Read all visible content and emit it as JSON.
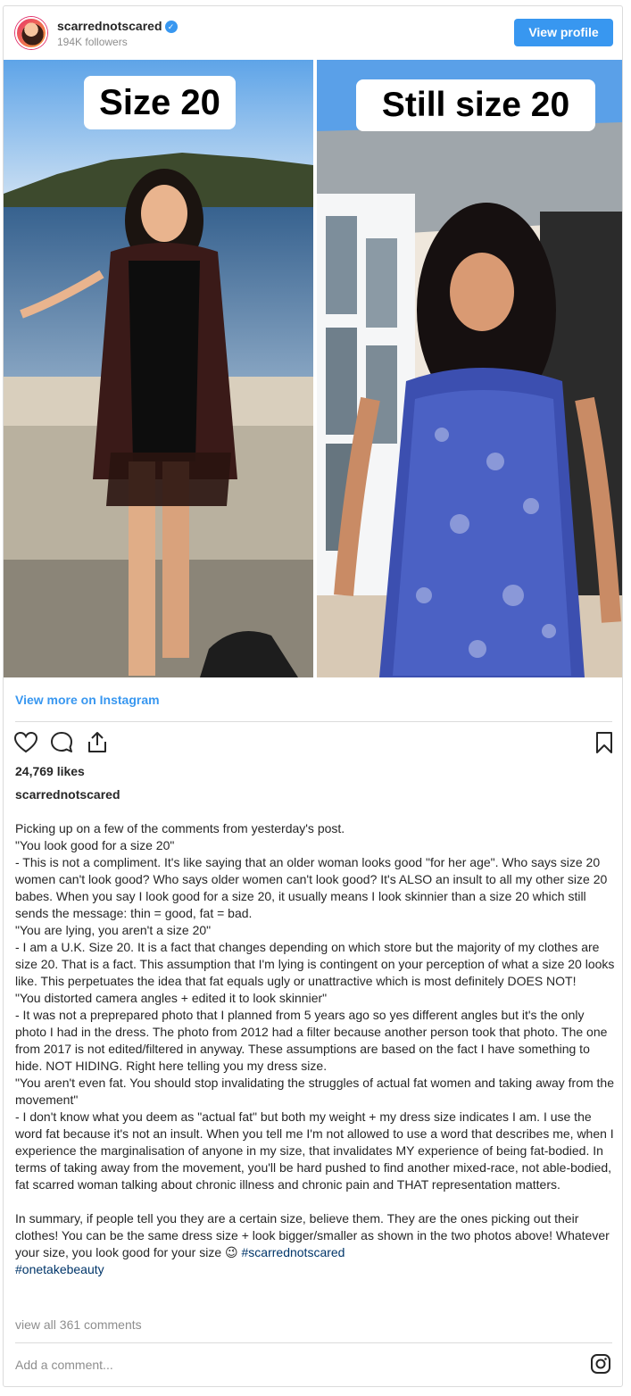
{
  "header": {
    "username": "scarrednotscared",
    "followers": "194K followers",
    "view_profile": "View profile"
  },
  "photos": {
    "left_label": "Size 20",
    "right_label": "Still size 20"
  },
  "view_more": "View more on Instagram",
  "likes": "24,769 likes",
  "owner": "scarrednotscared",
  "caption": {
    "body": "Picking up on a few of the comments from yesterday's post.\n\"You look good for a size 20\"\n- This is not a compliment. It's like saying that an older woman looks good \"for her age\". Who says size 20 women can't look good? Who says older women can't look good? It's ALSO an insult to all my other size 20 babes. When you say I look good for a size 20, it usually means I look skinnier than a size 20 which still sends the message: thin = good, fat = bad.\n\"You are lying, you aren't a size 20\"\n- I am a U.K. Size 20. It is a fact that changes depending on which store but the majority of my clothes are size 20. That is a fact. This assumption that I'm lying is contingent on your perception of what a size 20 looks like. This perpetuates the idea that fat equals ugly or unattractive which is most definitely DOES NOT!\n\"You distorted camera angles + edited it to look skinnier\"\n- It was not a preprepared photo that I planned from 5 years ago so yes different angles but it's the only photo I had in the dress. The photo from 2012 had a filter because another person took that photo. The one from 2017 is not edited/filtered in anyway. These assumptions are based on the fact I have something to hide. NOT HIDING. Right here telling you my dress size.\n\"You aren't even fat. You should stop invalidating the struggles of actual fat women and taking away from the movement\"\n- I don't know what you deem as \"actual fat\" but both my weight + my dress size indicates I am. I use the word fat because it's not an insult. When you tell me I'm not allowed to use a word that describes me, when I experience the marginalisation of anyone in my size, that invalidates MY experience of being fat-bodied. In terms of taking away from the movement, you'll be hard pushed to find another mixed-race, not able-bodied, fat scarred woman talking about chronic illness and chronic pain and THAT representation matters.\n\nIn summary, if people tell you they are a certain size, believe them. They are the ones picking out their clothes! You can be the same dress size + look bigger/smaller as shown in the two photos above! Whatever your size, you look good for your size ",
    "emoji": "😉",
    "hashtag1": "#scarrednotscared",
    "hashtag2": "#onetakebeauty"
  },
  "view_all_comments": "view all 361 comments",
  "add_comment_placeholder": "Add a comment...",
  "colors": {
    "accent": "#3897f0",
    "text": "#262626",
    "muted": "#8e8e8e",
    "border": "#dbdbdb"
  }
}
